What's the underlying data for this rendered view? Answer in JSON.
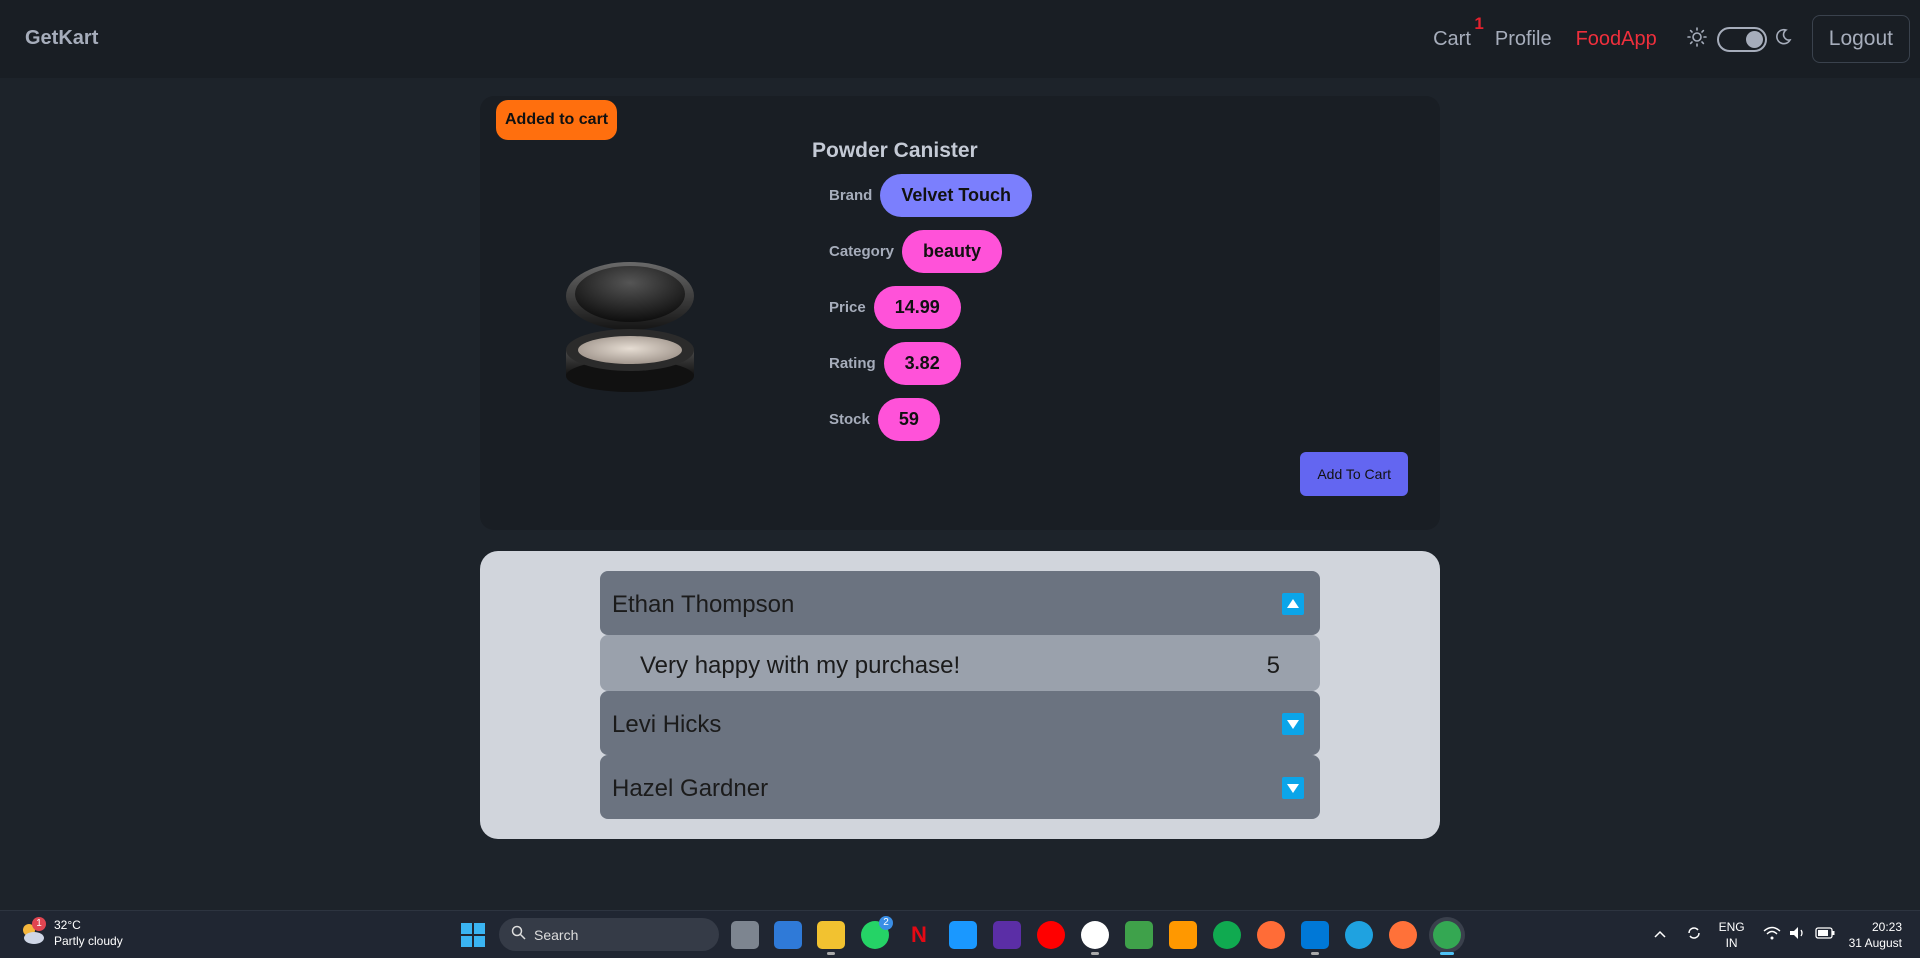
{
  "navbar": {
    "brand": "GetKart",
    "cart_label": "Cart",
    "cart_count": "1",
    "profile_label": "Profile",
    "foodapp_label": "FoodApp",
    "logout_label": "Logout",
    "theme_toggle_state": "dark"
  },
  "toast": {
    "text": "Added to cart"
  },
  "product": {
    "title": "Powder Canister",
    "brand_label": "Brand",
    "brand_value": "Velvet Touch",
    "category_label": "Category",
    "category_value": "beauty",
    "price_label": "Price",
    "price_value": "14.99",
    "rating_label": "Rating",
    "rating_value": "3.82",
    "stock_label": "Stock",
    "stock_value": "59",
    "add_to_cart_label": "Add To Cart"
  },
  "reviews": [
    {
      "name": "Ethan Thompson",
      "expanded": true,
      "comment": "Very happy with my purchase!",
      "rating": "5"
    },
    {
      "name": "Levi Hicks",
      "expanded": false
    },
    {
      "name": "Hazel Gardner",
      "expanded": false
    }
  ],
  "taskbar": {
    "weather_temp": "32°C",
    "weather_desc": "Partly cloudy",
    "weather_badge": "1",
    "search_placeholder": "Search",
    "whatsapp_badge": "2",
    "lang_top": "ENG",
    "lang_bottom": "IN",
    "time": "20:23",
    "date": "31 August"
  },
  "colors": {
    "accent": "#6366f1",
    "pill": "#ff52d9",
    "brand_pill": "#7b7ffd",
    "toast": "#ff6f0e",
    "foodapp": "#ef2f3c"
  }
}
